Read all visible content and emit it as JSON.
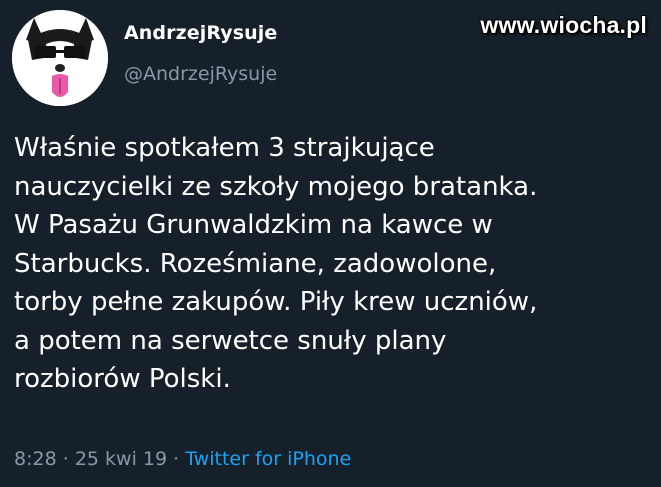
{
  "watermark": "www.wiocha.pl",
  "tweet": {
    "display_name": "AndrzejRysuje",
    "handle": "@AndrzejRysuje",
    "text_lines": [
      "Właśnie spotkałem 3 strajkujące",
      "nauczycielki ze szkoły mojego bratanka.",
      "W Pasażu Grunwaldzkim na kawce w",
      "Starbucks. Roześmiane, zadowolone,",
      "torby pełne zakupów. Piły krew uczniów,",
      "a potem na serwetce snuły plany",
      "rozbiorów Polski."
    ],
    "time": "8:28",
    "separator": "·",
    "date": "25 kwi 19",
    "source": "Twitter for iPhone"
  },
  "colors": {
    "background": "#15202b",
    "text": "#ffffff",
    "secondary": "#8899a6",
    "link": "#1da1f2"
  },
  "icons": {
    "avatar": "husky-dog-avatar-icon"
  }
}
